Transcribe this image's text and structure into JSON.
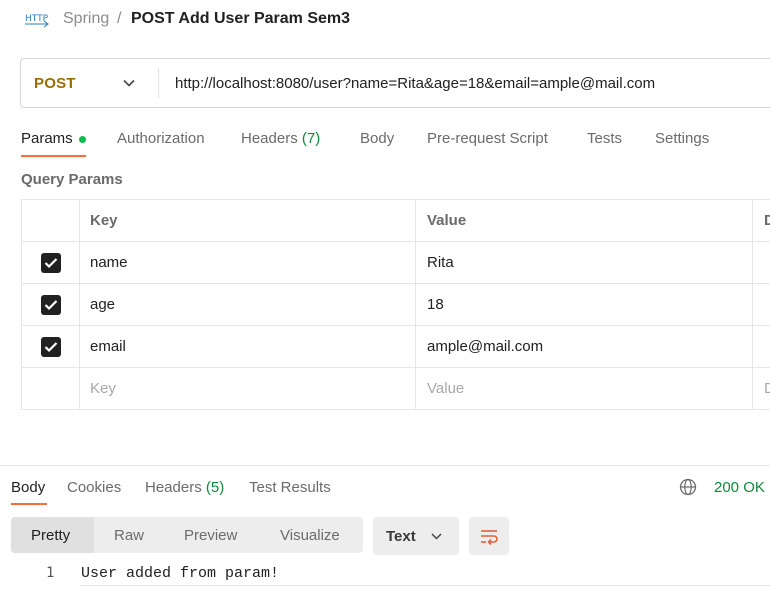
{
  "breadcrumb": {
    "icon_text": "HTTP",
    "parent": "Spring",
    "separator": "/",
    "title": "POST Add User Param Sem3"
  },
  "request": {
    "method": "POST",
    "url": "http://localhost:8080/user?name=Rita&age=18&email=ample@mail.com"
  },
  "request_tabs": [
    {
      "label": "Params",
      "active": true
    },
    {
      "label": "Authorization"
    },
    {
      "label": "Headers",
      "count": "(7)"
    },
    {
      "label": "Body"
    },
    {
      "label": "Pre-request Script"
    },
    {
      "label": "Tests"
    },
    {
      "label": "Settings"
    }
  ],
  "query_params": {
    "title": "Query Params",
    "headers": {
      "key": "Key",
      "value": "Value",
      "description": "Desc"
    },
    "rows": [
      {
        "checked": true,
        "key": "name",
        "value": "Rita"
      },
      {
        "checked": true,
        "key": "age",
        "value": "18"
      },
      {
        "checked": true,
        "key": "email",
        "value": "ample@mail.com"
      }
    ],
    "placeholders": {
      "key": "Key",
      "value": "Value",
      "description": "Desc"
    }
  },
  "response_tabs": [
    {
      "label": "Body",
      "active": true
    },
    {
      "label": "Cookies"
    },
    {
      "label": "Headers",
      "count": "(5)"
    },
    {
      "label": "Test Results"
    }
  ],
  "response_status": "200 OK",
  "view_modes": [
    "Pretty",
    "Raw",
    "Preview",
    "Visualize"
  ],
  "format": "Text",
  "code": [
    {
      "line": "1",
      "text": "User added from param!"
    }
  ],
  "colors": {
    "accent": "#ff6c37",
    "method_post": "#9a6d00",
    "status_ok": "#0f8a3c",
    "dot": "#0cbb52"
  }
}
